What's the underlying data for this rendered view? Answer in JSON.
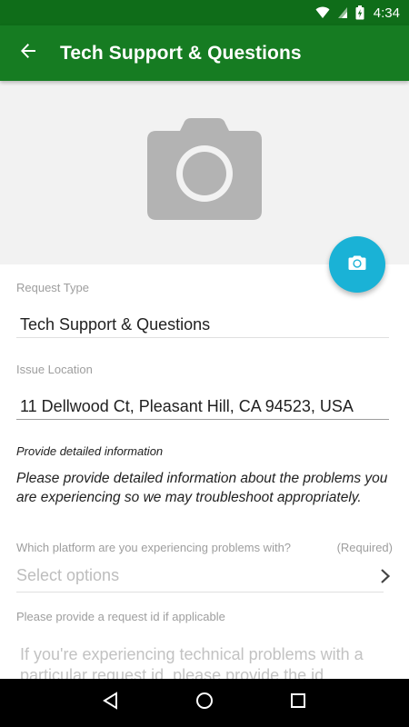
{
  "status_bar": {
    "time": "4:34"
  },
  "app_bar": {
    "title": "Tech Support & Questions"
  },
  "form": {
    "request_type": {
      "label": "Request Type",
      "value": "Tech Support & Questions"
    },
    "issue_location": {
      "label": "Issue Location",
      "value": "11 Dellwood Ct, Pleasant Hill, CA 94523, USA"
    },
    "details": {
      "heading": "Provide detailed information",
      "body": "Please provide detailed information about the problems you are experiencing so we may troubleshoot appropriately."
    },
    "platform": {
      "label": "Which platform are you experiencing problems with?",
      "required": "(Required)",
      "placeholder": "Select options"
    },
    "request_id": {
      "label": "Please provide a request id if applicable",
      "placeholder": "If you're experiencing technical problems with a particular request id, please provide the id."
    }
  },
  "colors": {
    "app_bar": "#167c22",
    "status_bar": "#0f6d19",
    "fab": "#1ab2d6"
  },
  "icons": {
    "back": "arrow-left-icon",
    "photo_placeholder": "camera-icon",
    "fab": "camera-icon",
    "select": "chevron-right-icon"
  }
}
